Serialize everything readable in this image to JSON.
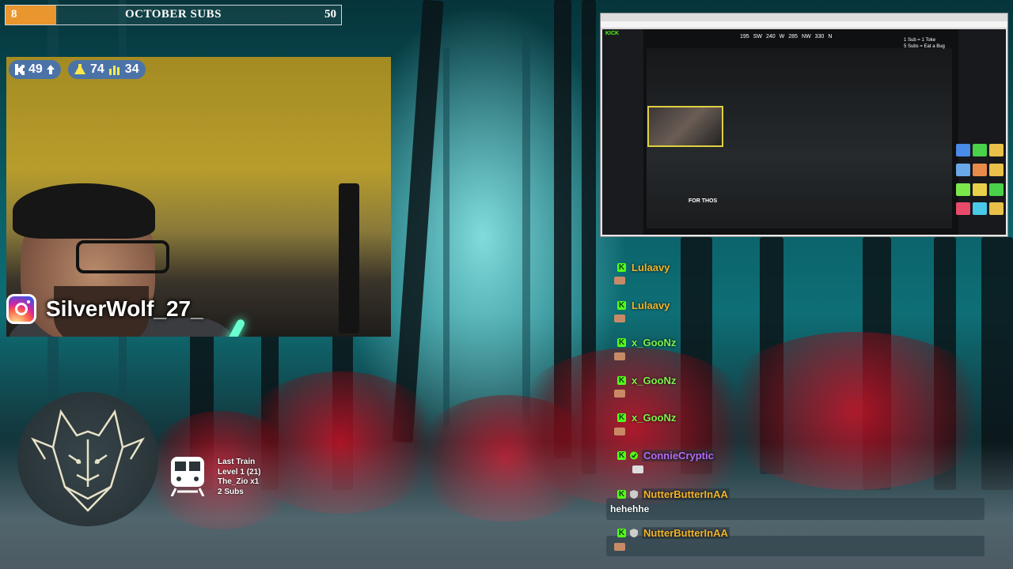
{
  "sub_goal": {
    "current": "8",
    "title": "OCTOBER SUBS",
    "target": "50",
    "progress_fraction": 0.16,
    "fill_color": "#e9962e"
  },
  "webcam": {
    "stats": {
      "kick_followers": "49",
      "follower_icon": "kick-k-arrow-up-icon",
      "user_count": "74",
      "viewers": "34"
    },
    "instagram_handle": "SilverWolf_27_"
  },
  "hype_train": {
    "lines": [
      "Last Train",
      "Level 1  (21)",
      "The_Zio x1",
      "2 Subs"
    ]
  },
  "browser_capture": {
    "logo": "KICK",
    "goal_line1": "1 Sub = 1 Toke",
    "goal_line2": "5 Subs = Eat a Bug",
    "compass": [
      "195",
      "SW",
      "240",
      "W",
      "285",
      "NW",
      "330",
      "N"
    ],
    "banner": "FOR THOS"
  },
  "chat": {
    "accent_color": "#53fc18",
    "messages": [
      {
        "user": "Lulaavy",
        "color": "#f0b429",
        "text": ""
      },
      {
        "user": "Lulaavy",
        "color": "#f0b429",
        "text": ""
      },
      {
        "user": "x_GooNz",
        "color": "#7cf24a",
        "text": ""
      },
      {
        "user": "x_GooNz",
        "color": "#7cf24a",
        "text": ""
      },
      {
        "user": "x_GooNz",
        "color": "#7cf24a",
        "text": ""
      },
      {
        "user": "ConnieCryptic",
        "color": "#b56cf5",
        "text": ""
      },
      {
        "user": "NutterButterInAA",
        "color": "#f0b429",
        "text": "hehehhe"
      },
      {
        "user": "NutterButterInAA",
        "color": "#f0b429",
        "text": ""
      }
    ]
  }
}
